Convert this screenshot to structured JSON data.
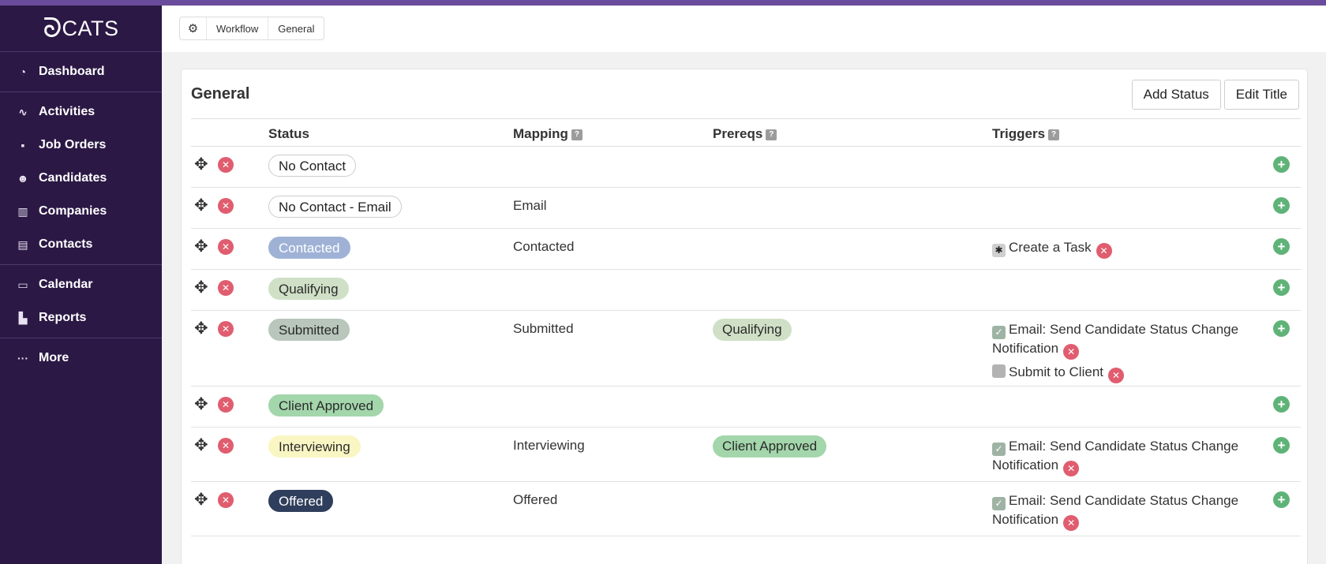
{
  "app": {
    "logo_text": "CATS"
  },
  "sidebar": {
    "groups": [
      [
        {
          "label": "Dashboard",
          "icon": "dashboard-icon",
          "glyph": "◔"
        }
      ],
      [
        {
          "label": "Activities",
          "icon": "pulse-icon",
          "glyph": "∿"
        },
        {
          "label": "Job Orders",
          "icon": "briefcase-icon",
          "glyph": "▪"
        },
        {
          "label": "Candidates",
          "icon": "user-star-icon",
          "glyph": "☻"
        },
        {
          "label": "Companies",
          "icon": "building-icon",
          "glyph": "▥"
        },
        {
          "label": "Contacts",
          "icon": "contact-book-icon",
          "glyph": "▤"
        }
      ],
      [
        {
          "label": "Calendar",
          "icon": "calendar-icon",
          "glyph": "▭"
        },
        {
          "label": "Reports",
          "icon": "bar-chart-icon",
          "glyph": "▙"
        }
      ],
      [
        {
          "label": "More",
          "icon": "more-dots-icon",
          "glyph": "···"
        }
      ]
    ]
  },
  "breadcrumb": {
    "items": [
      "Workflow",
      "General"
    ]
  },
  "card": {
    "title": "General",
    "add_status_label": "Add Status",
    "edit_title_label": "Edit Title"
  },
  "table": {
    "headers": {
      "status": "Status",
      "mapping": "Mapping",
      "prereqs": "Prereqs",
      "triggers": "Triggers",
      "help_glyph": "?"
    },
    "rows": [
      {
        "status": "No Contact",
        "status_bg": "#ffffff",
        "status_fg": "#222222",
        "status_border": "#cccccc",
        "mapping": "",
        "prereq": "",
        "triggers": []
      },
      {
        "status": "No Contact - Email",
        "status_bg": "#ffffff",
        "status_fg": "#222222",
        "status_border": "#cccccc",
        "mapping": "Email",
        "prereq": "",
        "triggers": []
      },
      {
        "status": "Contacted",
        "status_bg": "#9fb2d6",
        "status_fg": "#ffffff",
        "status_border": "#9fb2d6",
        "mapping": "Contacted",
        "prereq": "",
        "triggers": [
          {
            "label": "Create a Task",
            "kind": "required"
          }
        ]
      },
      {
        "status": "Qualifying",
        "status_bg": "#cfe0c6",
        "status_fg": "#2b2b2b",
        "status_border": "#cfe0c6",
        "mapping": "",
        "prereq": "",
        "triggers": []
      },
      {
        "status": "Submitted",
        "status_bg": "#b8c6bb",
        "status_fg": "#2b2b2b",
        "status_border": "#b8c6bb",
        "mapping": "Submitted",
        "prereq": "Qualifying",
        "prereq_bg": "#cfe0c6",
        "triggers": [
          {
            "label": "Email: Send Candidate Status Change Notification",
            "kind": "checked"
          },
          {
            "label": "Submit to Client",
            "kind": "unchecked"
          }
        ]
      },
      {
        "status": "Client Approved",
        "status_bg": "#a3d6ab",
        "status_fg": "#2b2b2b",
        "status_border": "#a3d6ab",
        "mapping": "",
        "prereq": "",
        "triggers": []
      },
      {
        "status": "Interviewing",
        "status_bg": "#faf6c4",
        "status_fg": "#2b2b2b",
        "status_border": "#faf6c4",
        "mapping": "Interviewing",
        "prereq": "Client Approved",
        "prereq_bg": "#a3d6ab",
        "triggers": [
          {
            "label": "Email: Send Candidate Status Change Notification",
            "kind": "checked"
          }
        ]
      },
      {
        "status": "Offered",
        "status_bg": "#2f3e5c",
        "status_fg": "#ffffff",
        "status_border": "#2f3e5c",
        "mapping": "Offered",
        "prereq": "",
        "triggers": [
          {
            "label": "Email: Send Candidate Status Change Notification",
            "kind": "checked"
          }
        ]
      }
    ]
  },
  "colors": {
    "sidebar_bg": "#2b1845",
    "topbar": "#6a4c9c",
    "delete": "#e05d6f",
    "add": "#5fb378"
  }
}
